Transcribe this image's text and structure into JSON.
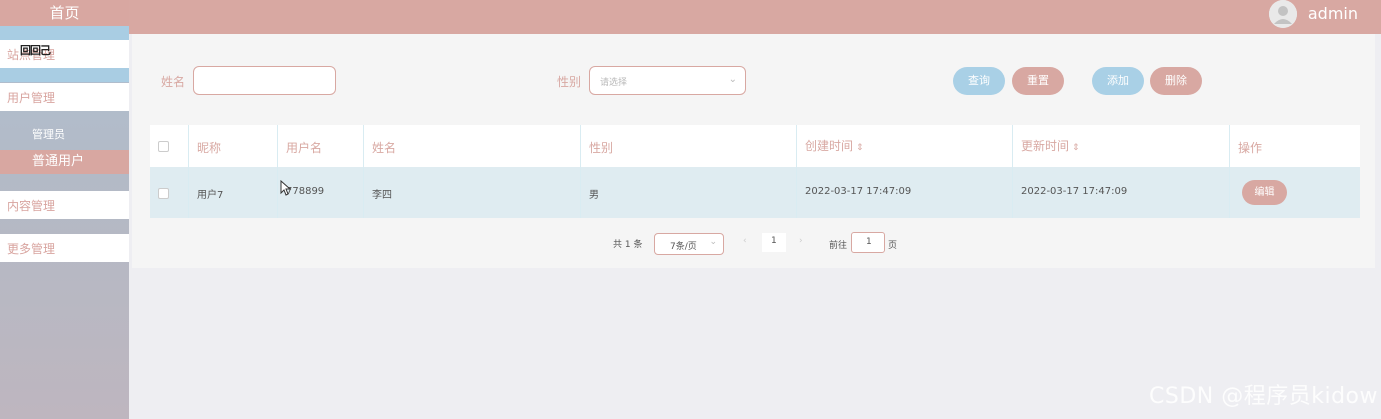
{
  "sidebar": {
    "home": "首页",
    "overlay_text": "回回己",
    "items": [
      {
        "label": "站点管理"
      },
      {
        "label": "用户管理"
      },
      {
        "label": "管理员"
      },
      {
        "label": "普通用户"
      },
      {
        "label": "内容管理"
      },
      {
        "label": "更多管理"
      }
    ]
  },
  "header": {
    "username": "admin"
  },
  "search": {
    "name_label": "姓名",
    "name_value": "",
    "gender_label": "性别",
    "gender_placeholder": "请选择"
  },
  "buttons": {
    "query": "查询",
    "reset": "重置",
    "add": "添加",
    "delete": "删除"
  },
  "table": {
    "headers": [
      "昵称",
      "用户名",
      "姓名",
      "性别",
      "创建时间",
      "更新时间",
      "操作"
    ],
    "rows": [
      [
        "用户7",
        "778899",
        "李四",
        "男",
        "2022-03-17 17:47:09",
        "2022-03-17 17:47:09",
        "编辑"
      ]
    ]
  },
  "pagination": {
    "total": "共 1 条",
    "page_size": "7条/页",
    "current_page": "1",
    "goto_label": "前往",
    "goto_value": "1",
    "page_unit": "页"
  },
  "watermark": "CSDN @程序员kidow",
  "colors": {
    "accent_pink": "#d8a8a2",
    "accent_blue": "#a9d0e6"
  }
}
